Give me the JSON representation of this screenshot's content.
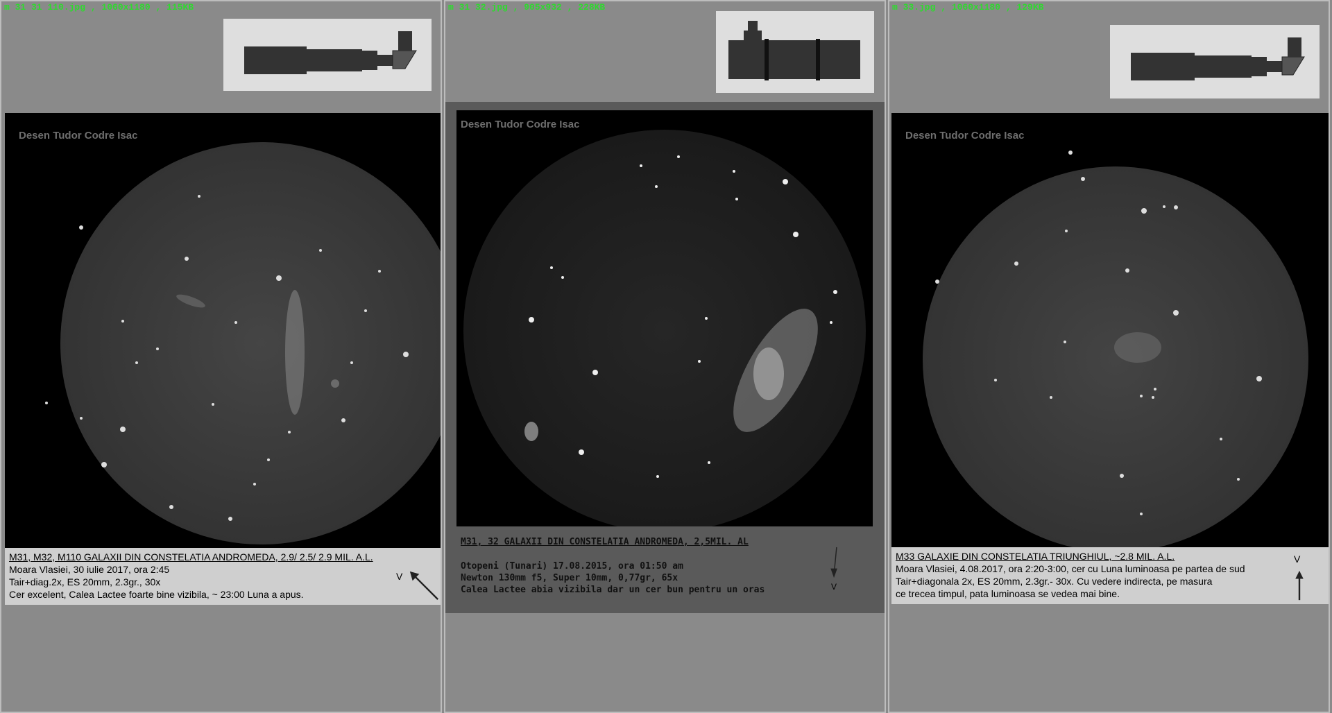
{
  "colors": {
    "background": "#8a8a8a",
    "header_text": "#2fd92f",
    "caption_panel": "#cfcfcf",
    "sketch_field": "#3b3b3b",
    "watermark": "#6e6e6e"
  },
  "panels": [
    {
      "file_header": "m 31 31 110.jpg , 1060x1180 , 115KB",
      "watermark": "Desen Tudor Codre Isac",
      "caption": {
        "title": "M31, M32, M110 GALAXII DIN CONSTELATIA ANDROMEDA, 2.9/ 2.5/ 2.9 MIL. A.L.",
        "lines": [
          "Moara Vlasiei, 30 iulie 2017, ora 2:45",
          "Tair+diag.2x, ES 20mm, 2.3gr., 30x",
          "Cer excelent, Calea Lactee foarte bine vizibila, ~ 23:00 Luna a apus."
        ],
        "north_marker": "V"
      },
      "scope_icon": "refractor-diagonal-icon"
    },
    {
      "file_header": "m 31 32.jpg , 905x932 , 228KB",
      "watermark": "Desen Tudor Codre Isac",
      "caption": {
        "title": "M31, 32  GALAXII DIN CONSTELATIA ANDROMEDA, 2,5MIL. AL",
        "lines": [
          "Otopeni (Tunari) 17.08.2015, ora 01:50 am",
          "Newton 130mm f5, Super 10mm, 0,77gr, 65x",
          "Calea Lactee abia vizibila dar un cer bun pentru un oras"
        ],
        "north_marker": "V"
      },
      "scope_icon": "newtonian-tube-icon"
    },
    {
      "file_header": "m 33.jpg , 1060x1180 , 129KB",
      "watermark": "Desen Tudor Codre Isac",
      "caption": {
        "title": "M33 GALAXIE DIN CONSTELATIA TRIUNGHIUL, ~2.8 MIL. A.L.",
        "lines": [
          "Moara Vlasiei, 4.08.2017, ora 2:20-3:00, cer cu Luna luminoasa pe partea de sud",
          "Tair+diagonala 2x, ES 20mm, 2.3gr.- 30x. Cu vedere indirecta, pe masura",
          "ce trecea timpul, pata luminoasa se vedea mai bine."
        ],
        "north_marker": "V"
      },
      "scope_icon": "refractor-diagonal-icon"
    }
  ]
}
